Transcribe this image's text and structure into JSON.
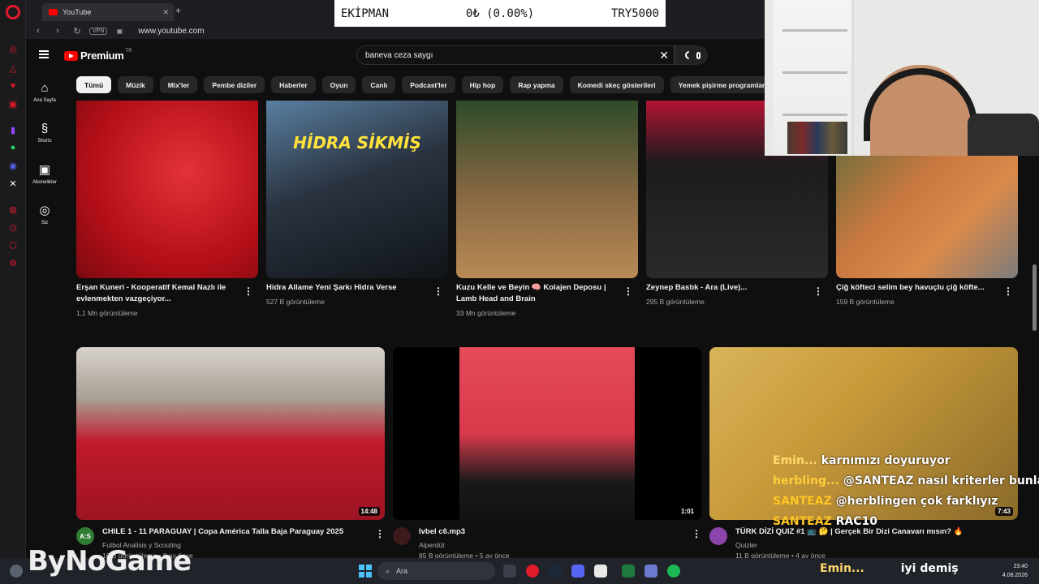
{
  "browser": {
    "tab_title": "YouTube",
    "url": "www.youtube.com",
    "vpn_label": "VPN"
  },
  "ticker": {
    "label": "EKİPMAN",
    "value": "0₺ (0.00%)",
    "target": "TRY5000"
  },
  "yt": {
    "logo": "Premium",
    "logo_suffix": "TR",
    "search_value": "baneva ceza saygı",
    "nav": [
      {
        "label": "Ana Sayfa",
        "icon": "home-icon"
      },
      {
        "label": "Shorts",
        "icon": "shorts-icon"
      },
      {
        "label": "Abonelikler",
        "icon": "subscriptions-icon"
      },
      {
        "label": "Siz",
        "icon": "account-icon"
      }
    ],
    "chips": [
      "Tümü",
      "Müzik",
      "Mix'ler",
      "Pembe diziler",
      "Haberler",
      "Oyun",
      "Canlı",
      "Podcast'ler",
      "Hip hop",
      "Rap yapma",
      "Komedi skeç gösterileri",
      "Yemek pişirme programları"
    ]
  },
  "videos_row1": [
    {
      "title": "Erşan Kuneri - Kooperatif Kemal Nazlı ile evlenmekten vazgeçiyor...",
      "meta": "1,1 Mn görüntüleme",
      "thumb_color": "#c4121b"
    },
    {
      "title": "Hidra Allame Yeni Şarkı Hidra Verse",
      "meta": "527 B görüntüleme",
      "thumb_text": "HİDRA SİKMİŞ",
      "thumb_color": "#2a3340"
    },
    {
      "title": "Kuzu Kelle ve Beyin 🧠 Kolajen Deposu | Lamb Head and Brain",
      "meta": "33 Mn görüntüleme",
      "thumb_color": "#6a5a3c"
    },
    {
      "title": "Zeynep Bastık - Ara (Live)...",
      "meta": "295 B görüntüleme",
      "thumb_color": "#1d1b1e"
    },
    {
      "title": "Çiğ köfteci selim bey havuçlu çiğ köfte...",
      "meta": "159 B görüntüleme",
      "thumb_color": "#c8773f"
    }
  ],
  "videos_row2": [
    {
      "title": "CHILE 1 - 11 PARAGUAY | Copa América Talla Baja Paraguay 2025",
      "channel": "Futbol Analisis y Scouting",
      "meta": "16 B görüntüleme • 8 ay önce",
      "duration": "14:48",
      "avatar": "A:S"
    },
    {
      "title": "Ivbel c6.mp3",
      "channel": "Alperdüt",
      "meta": "85 B görüntüleme • 5 ay önce",
      "duration": "1:01",
      "avatar": ""
    },
    {
      "title": "TÜRK DİZİ QUIZ #1 📺 🤔 | Gerçek Bir Dizi Canavarı mısın? 🔥",
      "channel": "Quizler",
      "meta": "11 B görüntüleme • 4 ay önce",
      "duration": "7:43",
      "avatar": ""
    }
  ],
  "quiz_thumb_text": "TÜRK DİZİ QUIZ #1",
  "chat": [
    {
      "name": "Emin...",
      "message": "karnımızı doyuruyor"
    },
    {
      "name": "herbling...",
      "message": "@SANTEAZ nasıl kriterler bunlar kral"
    },
    {
      "name": "SANTEAZ",
      "message": "@herblingen çok farklıyız"
    },
    {
      "name": "SANTEAZ",
      "message": "RAC10"
    },
    {
      "name": "Emin...",
      "message": "iyi demiş"
    }
  ],
  "taskbar": {
    "search_placeholder": "Ara",
    "time": "23:40",
    "date": "4.08.2026"
  },
  "brand": "ByNoGame",
  "colors": {
    "yt_red": "#ff0000",
    "bg": "#0f0f0f",
    "chip": "#272727",
    "opera_red": "#e0192b"
  }
}
